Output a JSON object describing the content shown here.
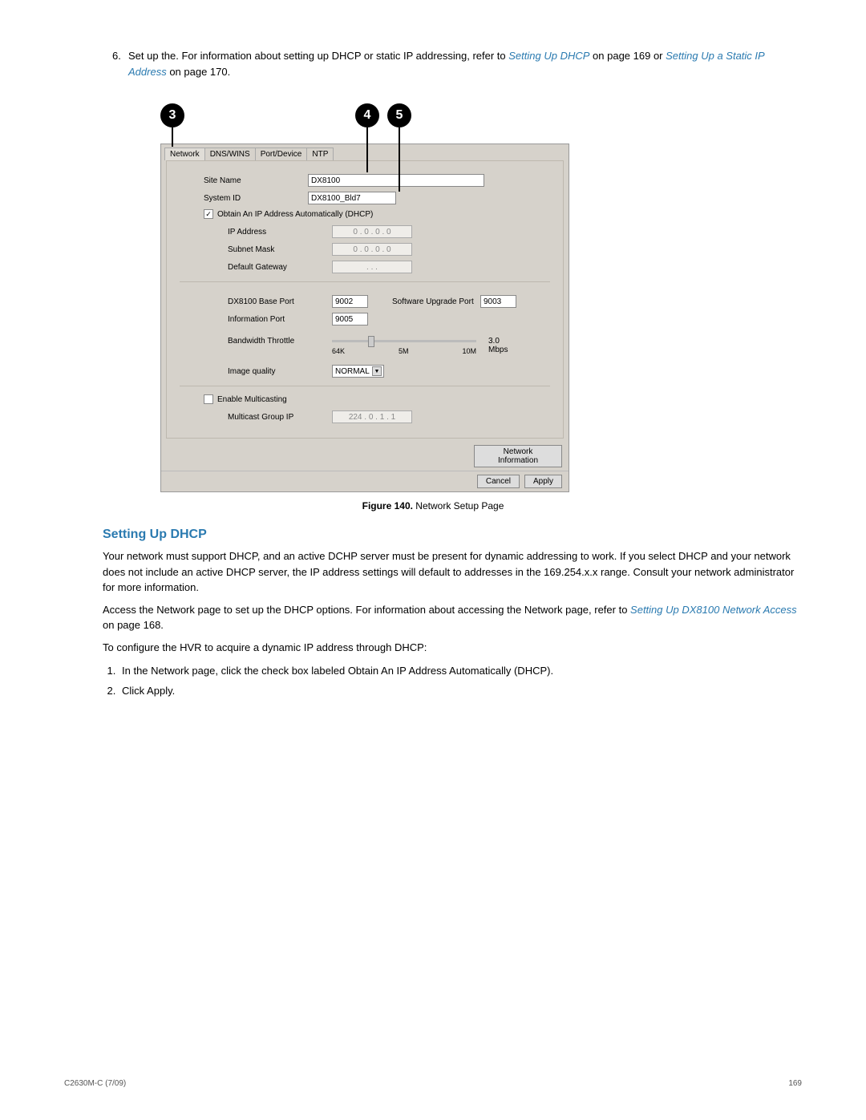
{
  "step6": {
    "number": "6.",
    "intro": "Set up the. For information about setting up DHCP or static IP addressing, refer to ",
    "link1": "Setting Up DHCP",
    "mid1": " on page 169 or ",
    "link2": "Setting Up a Static IP Address",
    "tail": " on page 170."
  },
  "callouts": {
    "c3": "3",
    "c4": "4",
    "c5": "5"
  },
  "tabs": {
    "network": "Network",
    "dns": "DNS/WINS",
    "port": "Port/Device",
    "ntp": "NTP"
  },
  "form": {
    "site_name_label": "Site Name",
    "site_name_value": "DX8100",
    "system_id_label": "System ID",
    "system_id_value": "DX8100_Bld7",
    "dhcp_checkbox": "Obtain An IP Address Automatically (DHCP)",
    "ip_label": "IP Address",
    "ip_display": "0   .   0   .   0   .   0",
    "subnet_label": "Subnet Mask",
    "subnet_display": "0   .   0   .   0   .   0",
    "gateway_label": "Default Gateway",
    "gateway_display": ".       .       .",
    "base_port_label": "DX8100 Base Port",
    "base_port_value": "9002",
    "upgrade_port_label": "Software Upgrade Port",
    "upgrade_port_value": "9003",
    "info_port_label": "Information Port",
    "info_port_value": "9005",
    "bw_label": "Bandwidth Throttle",
    "bw_value": "3.0 Mbps",
    "t64k": "64K",
    "t5m": "5M",
    "t10m": "10M",
    "quality_label": "Image quality",
    "quality_value": "NORMAL",
    "multicast_checkbox": "Enable Multicasting",
    "multicast_ip_label": "Multicast Group IP",
    "multicast_ip_value": "224   .   0   .   1   .   1",
    "netinfo_btn": "Network Information",
    "cancel_btn": "Cancel",
    "apply_btn": "Apply"
  },
  "figcap": {
    "bold": "Figure 140.",
    "rest": "  Network Setup Page"
  },
  "section_title": "Setting Up DHCP",
  "para1": "Your network must support DHCP, and an active DCHP server must be present for dynamic addressing to work. If you select DHCP and your network does not include an active DHCP server, the IP address settings will default to addresses in the 169.254.x.x range. Consult your network administrator for more information.",
  "para2_pre": "Access the Network page to set up the DHCP options. For information about accessing the Network page, refer to ",
  "para2_link": "Setting Up DX8100 Network Access",
  "para2_post": " on page 168.",
  "para3": "To configure the HVR to acquire a dynamic IP address through DHCP:",
  "steps": {
    "s1": "In the Network page, click the check box labeled Obtain An IP Address Automatically (DHCP).",
    "s2": "Click Apply."
  },
  "footer": {
    "left": "C2630M-C (7/09)",
    "right": "169"
  }
}
